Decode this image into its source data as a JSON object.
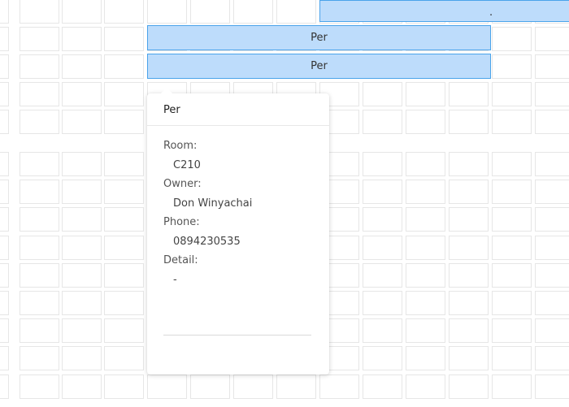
{
  "events": [
    {
      "title": "."
    },
    {
      "title": "Per"
    },
    {
      "title": "Per"
    }
  ],
  "popover": {
    "title": "Per",
    "fields": [
      {
        "label": "Room:",
        "value": "C210"
      },
      {
        "label": "Owner:",
        "value": "Don Winyachai"
      },
      {
        "label": "Phone:",
        "value": "0894230535"
      },
      {
        "label": "Detail:",
        "value": "-"
      }
    ]
  },
  "colors": {
    "event_fill": "#bddcfb",
    "event_border": "#4aa3ea",
    "grid_line": "#e6e6e6"
  }
}
